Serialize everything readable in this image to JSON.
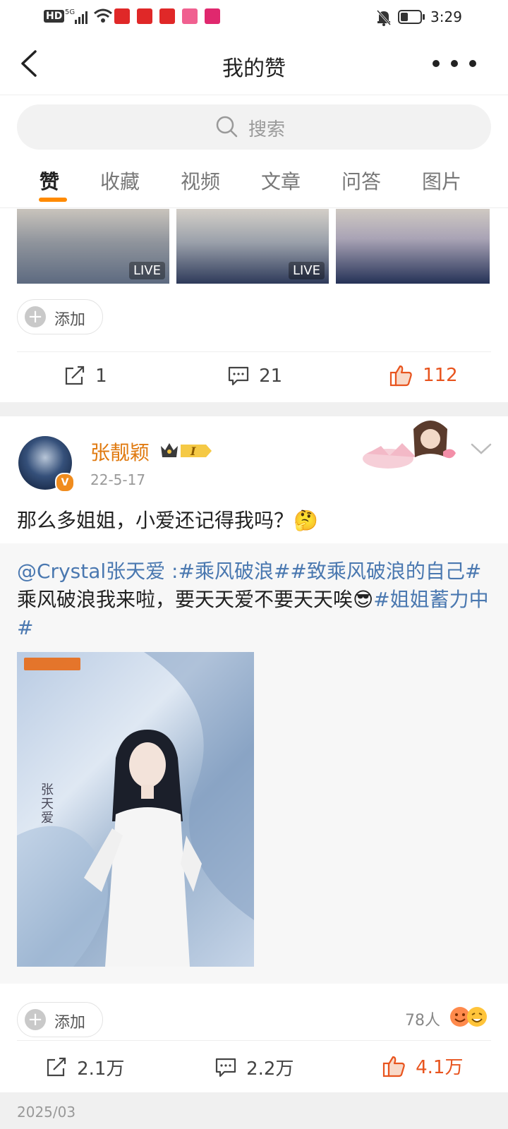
{
  "status_bar": {
    "left_icons": [
      "hd-icon",
      "5g-signal-icon",
      "wifi-icon"
    ],
    "time": "3:29",
    "app_icon_colors": [
      "#e02828",
      "#e02828",
      "#e02828",
      "#f06090",
      "#e0286e"
    ]
  },
  "header": {
    "title": "我的赞"
  },
  "search": {
    "placeholder": "搜索"
  },
  "tabs": [
    {
      "label": "赞",
      "active": true
    },
    {
      "label": "收藏",
      "active": false
    },
    {
      "label": "视频",
      "active": false
    },
    {
      "label": "文章",
      "active": false
    },
    {
      "label": "问答",
      "active": false
    },
    {
      "label": "图片",
      "active": false
    }
  ],
  "post1": {
    "thumbnails": [
      {
        "live": "LIVE"
      },
      {
        "live": "LIVE"
      },
      {
        "live": ""
      }
    ],
    "add_label": "添加",
    "actions": {
      "repost": "1",
      "comments": "21",
      "likes": "112"
    }
  },
  "post2": {
    "author": "张靓颖",
    "date": "22-5-17",
    "text": "那么多姐姐，小爱还记得我吗？🤔",
    "repost": {
      "mention": "@Crystal张天爱",
      "sep": " :",
      "tag1": "#乘风破浪#",
      "tag2": "#致乘风破浪的自己#",
      "line2": "乘风破浪我来啦，要天天爱不要天天唉😎",
      "tag3": "#姐姐蓄力中#",
      "image_caption": "张天爱"
    },
    "add_label": "添加",
    "reactions_count": "78人",
    "actions": {
      "repost": "2.1万",
      "comments": "2.2万",
      "likes": "4.1万"
    }
  },
  "footer_date": "2025/03",
  "colors": {
    "accent": "#ff8a00",
    "liked": "#e8541e",
    "link": "#4a78b0",
    "author": "#e07a10"
  }
}
